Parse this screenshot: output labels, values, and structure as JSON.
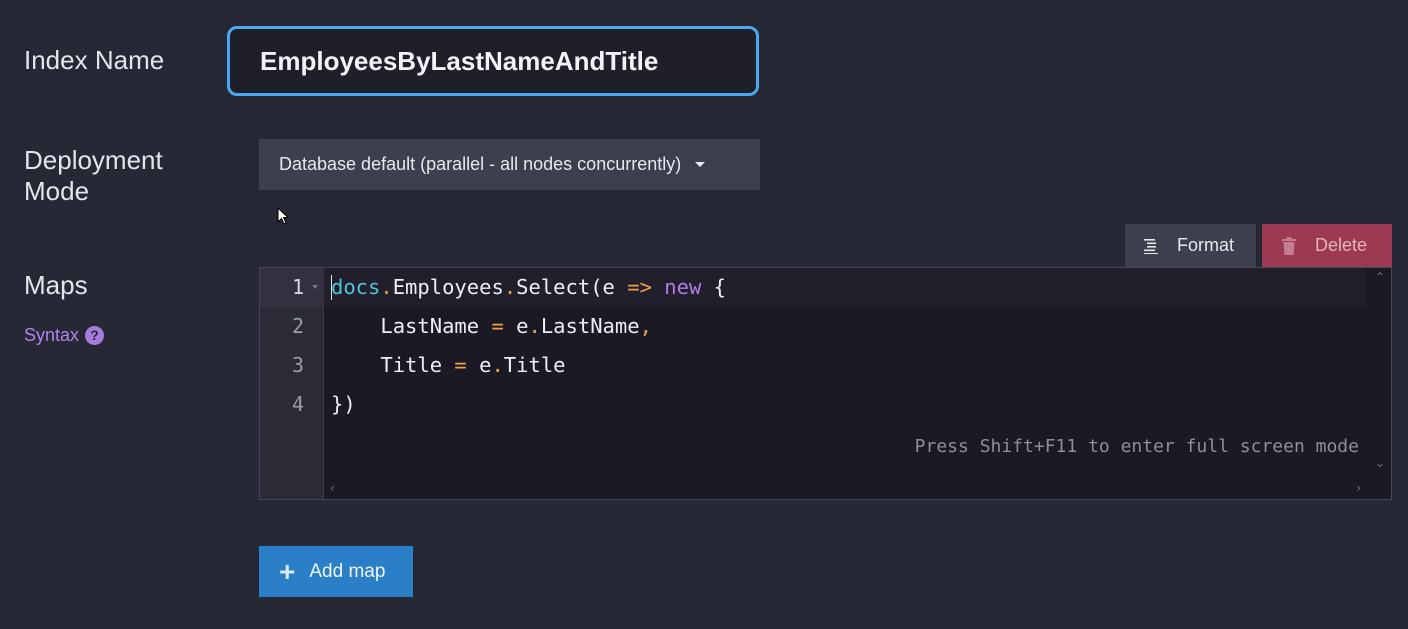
{
  "index_name": {
    "label": "Index Name",
    "value": "EmployeesByLastNameAndTitle"
  },
  "deployment": {
    "label": "Deployment Mode",
    "selected": "Database default (parallel - all nodes concurrently)"
  },
  "maps": {
    "label": "Maps",
    "syntax_link": "Syntax",
    "help_icon_glyph": "?",
    "toolbar": {
      "format_label": "Format",
      "delete_label": "Delete"
    },
    "editor": {
      "line_numbers": [
        "1",
        "2",
        "3",
        "4"
      ],
      "lines": [
        [
          {
            "t": "kw",
            "v": "docs"
          },
          {
            "t": "op",
            "v": "."
          },
          {
            "t": "id",
            "v": "Employees"
          },
          {
            "t": "op",
            "v": "."
          },
          {
            "t": "id",
            "v": "Select(e "
          },
          {
            "t": "op",
            "v": "=>"
          },
          {
            "t": "id",
            "v": " "
          },
          {
            "t": "new",
            "v": "new"
          },
          {
            "t": "id",
            "v": " {"
          }
        ],
        [
          {
            "t": "id",
            "v": "    LastName "
          },
          {
            "t": "op",
            "v": "="
          },
          {
            "t": "id",
            "v": " e"
          },
          {
            "t": "op",
            "v": "."
          },
          {
            "t": "id",
            "v": "LastName"
          },
          {
            "t": "op",
            "v": ","
          }
        ],
        [
          {
            "t": "id",
            "v": "    Title "
          },
          {
            "t": "op",
            "v": "="
          },
          {
            "t": "id",
            "v": " e"
          },
          {
            "t": "op",
            "v": "."
          },
          {
            "t": "id",
            "v": "Title"
          }
        ],
        [
          {
            "t": "id",
            "v": "})"
          }
        ]
      ],
      "hint": "Press Shift+F11 to enter full screen mode"
    },
    "add_map_label": "Add map",
    "add_map_glyph": "+"
  },
  "colors": {
    "background": "#262935",
    "accent_blue": "#2a7fc6",
    "focus_border": "#4aa8f0",
    "delete_red": "#9b3a52",
    "syntax_purple": "#b283ec"
  }
}
